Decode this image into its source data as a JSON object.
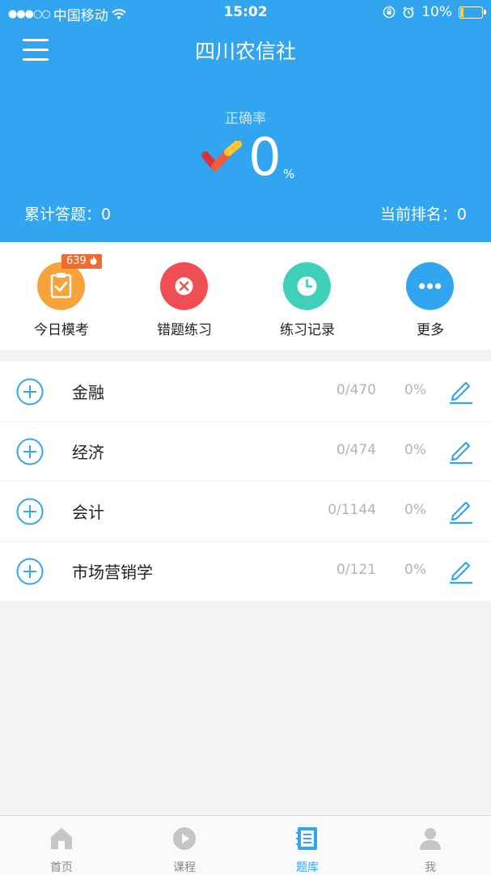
{
  "status_bar": {
    "carrier": "中国移动",
    "signal_dots": "●●●○○",
    "time": "15:02",
    "battery": "10%"
  },
  "header": {
    "title": "四川农信社",
    "accuracy_label": "正确率",
    "accuracy_value": "0",
    "accuracy_unit": "%",
    "total_answers": "累计答题：0",
    "current_rank": "当前排名：0"
  },
  "quick_actions": [
    {
      "label": "今日模考",
      "badge": "639",
      "icon": "clipboard-check-icon",
      "color": "#f8a23c"
    },
    {
      "label": "错题练习",
      "icon": "x-icon",
      "color": "#ef4e55"
    },
    {
      "label": "练习记录",
      "icon": "clock-icon",
      "color": "#3ed0b9"
    },
    {
      "label": "更多",
      "icon": "more-dots-icon",
      "color": "#31a5f0"
    }
  ],
  "subjects": [
    {
      "name": "金融",
      "count": "0/470",
      "percent": "0%"
    },
    {
      "name": "经济",
      "count": "0/474",
      "percent": "0%"
    },
    {
      "name": "会计",
      "count": "0/1144",
      "percent": "0%"
    },
    {
      "name": "市场营销学",
      "count": "0/121",
      "percent": "0%"
    }
  ],
  "tabs": [
    {
      "label": "首页",
      "icon": "home-icon"
    },
    {
      "label": "课程",
      "icon": "play-icon"
    },
    {
      "label": "题库",
      "icon": "notebook-icon",
      "active": true
    },
    {
      "label": "我",
      "icon": "user-icon"
    }
  ],
  "colors": {
    "primary": "#31a5f0",
    "text": "#222222",
    "muted": "#b4b4b4"
  }
}
